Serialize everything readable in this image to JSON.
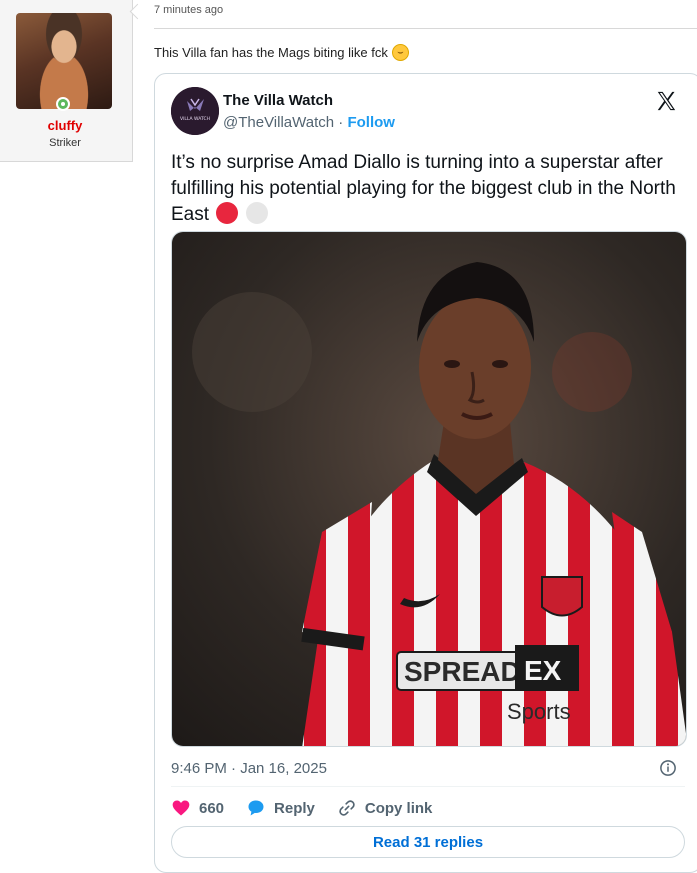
{
  "user": {
    "name": "cluffy",
    "title": "Striker",
    "status": "online"
  },
  "post": {
    "time": "7 minutes ago",
    "text": "This Villa fan has the Mags biting like fck",
    "emoji": "rolling-on-floor-laughing"
  },
  "tweet": {
    "author_name": "The Villa Watch",
    "handle": "@TheVillaWatch",
    "separator": "·",
    "follow_label": "Follow",
    "avatar_text": "VILLA WATCH",
    "body": "It’s no surprise Amad Diallo is turning into a superstar after fulfilling his potential playing for the biggest club in the North East",
    "flags": [
      "#e8263e",
      "#e6e6e6"
    ],
    "timestamp": "9:46 PM · Jan 16, 2025",
    "likes": "660",
    "reply_label": "Reply",
    "copy_label": "Copy link",
    "read_replies": "Read 31 replies",
    "sponsor_top": "SPREAD",
    "sponsor_ex": "EX",
    "sponsor_bottom": "Sports"
  },
  "colors": {
    "username": "#e00000",
    "link": "#1d9bf0",
    "like": "#f91880",
    "kit_red": "#d0162a"
  }
}
